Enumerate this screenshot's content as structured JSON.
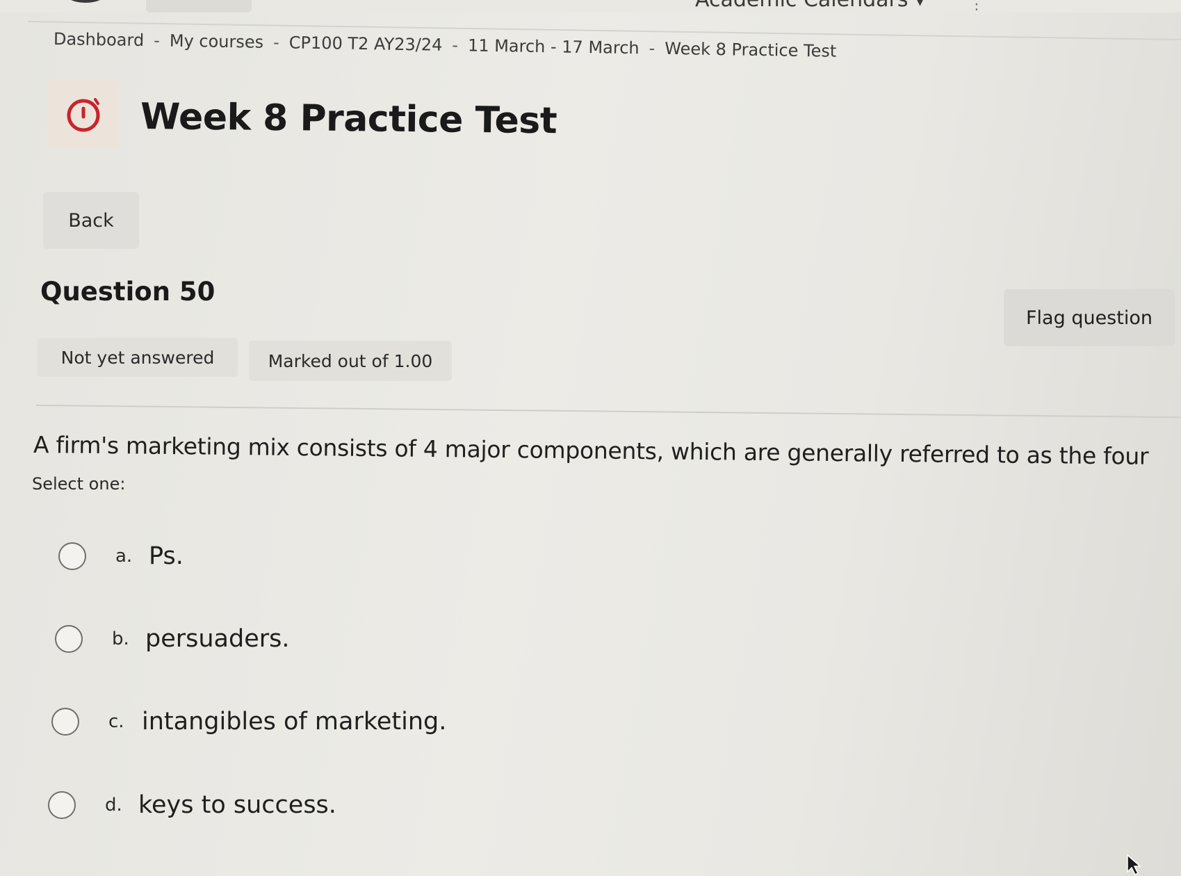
{
  "top_bar": {
    "menu_text": "Academic Calendars ▾"
  },
  "breadcrumb": [
    "Dashboard",
    "My courses",
    "CP100 T2 AY23/24",
    "11 March - 17 March",
    "Week 8 Practice Test"
  ],
  "breadcrumb_separator": "-",
  "page": {
    "title": "Week 8 Practice Test",
    "icon": "stopwatch-icon",
    "icon_color": "#c8242c",
    "back_label": "Back"
  },
  "question": {
    "title": "Question 50",
    "status": "Not yet answered",
    "marks": "Marked out of 1.00",
    "flag_label": "Flag question",
    "text": "A firm's marketing mix consists of 4 major components, which are generally referred to as the four",
    "select_label": "Select one:",
    "options": [
      {
        "letter": "a.",
        "text": "Ps."
      },
      {
        "letter": "b.",
        "text": "persuaders."
      },
      {
        "letter": "c.",
        "text": "intangibles of marketing."
      },
      {
        "letter": "d.",
        "text": "keys to success."
      }
    ]
  }
}
